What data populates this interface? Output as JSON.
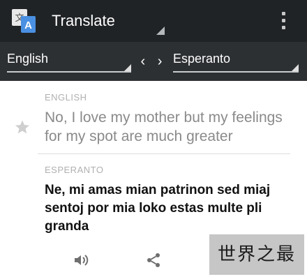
{
  "app_bar": {
    "title": "Translate",
    "icons": [
      "translate-app-icon",
      "overflow-menu-icon"
    ]
  },
  "language_bar": {
    "source_language": "English",
    "target_language": "Esperanto",
    "swap_symbol": "‹ ›"
  },
  "source": {
    "label": "ENGLISH",
    "text": "No, I love my mother but my feelings for my spot are much greater"
  },
  "translation": {
    "label": "ESPERANTO",
    "text": "Ne, mi amas mian patrinon sed miaj sentoj por mia loko estas multe pli granda"
  },
  "actions": [
    "speaker-icon",
    "share-icon"
  ],
  "watermark": "世界之最",
  "colors": {
    "app_bar": "#202326",
    "language_bar": "#2d3033",
    "source_text": "#8a8a8a",
    "translation_text": "#111111"
  }
}
